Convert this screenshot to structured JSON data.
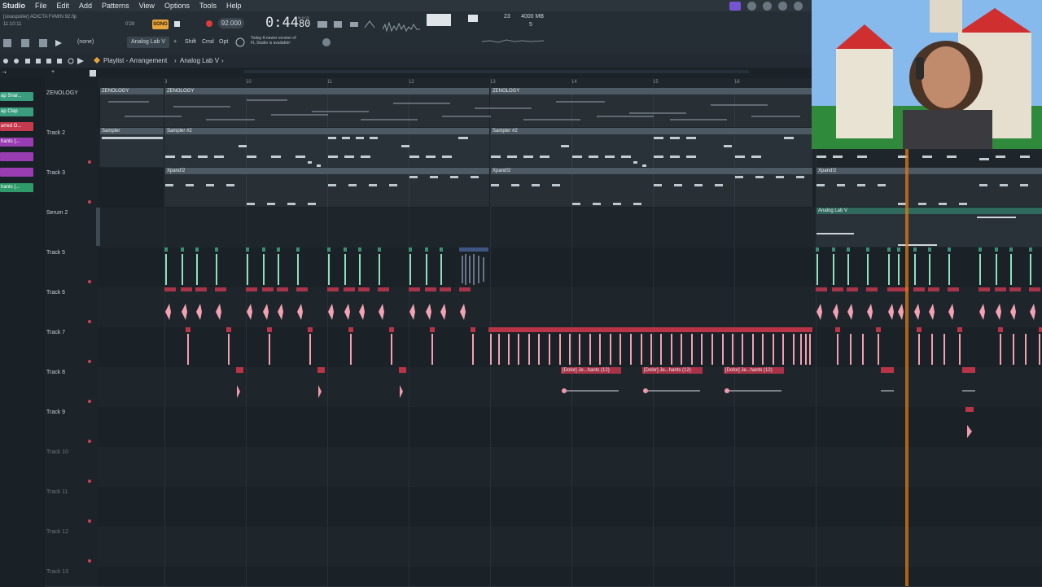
{
  "menubar": {
    "app": "Studio",
    "items": [
      "File",
      "Edit",
      "Add",
      "Patterns",
      "View",
      "Options",
      "Tools",
      "Help"
    ]
  },
  "toolbar": {
    "project_tag": "[sixaspoiler] ADICTA F#MIN 92.flp",
    "project_time": "11:10:11",
    "pattern_small": "0'28",
    "song_label": "SONG",
    "tempo": "92.000",
    "time_main": "0:44",
    "time_frac": "80",
    "time_unit": "M:S:CS",
    "cpu": "23",
    "memory": "4000 MB",
    "voices": "5",
    "voice_count": "0",
    "preset": "(none)",
    "plugin_button": "Analog Lab V",
    "shift_label": "Shift",
    "cmd_label": "Cmd",
    "opt_label": "Opt",
    "update_line1": "Today  A newer version of",
    "update_line2": "FL Studio is available!"
  },
  "breadcrumb": {
    "title": "Playlist - Arrangement",
    "current": "Analog Lab V"
  },
  "ruler": {
    "marks": [
      {
        "label": "9"
      },
      {
        "label": "10"
      },
      {
        "label": "11"
      },
      {
        "label": "12"
      },
      {
        "label": "13"
      },
      {
        "label": "14"
      },
      {
        "label": "15"
      },
      {
        "label": "16"
      }
    ]
  },
  "channel_rack": [
    {
      "label": "ap Snar...",
      "color": "g"
    },
    {
      "label": "ap Clap",
      "color": "g"
    },
    {
      "label": "arred O...",
      "color": "r"
    },
    {
      "label": "hants (...",
      "color": "p"
    },
    {
      "label": "",
      "color": "p"
    },
    {
      "label": "",
      "color": "p"
    },
    {
      "label": "hants (...",
      "color": "gr"
    }
  ],
  "tracks": [
    {
      "name": "ZENOLOGY"
    },
    {
      "name": "Track 2"
    },
    {
      "name": "Track 3"
    },
    {
      "name": "Serum 2"
    },
    {
      "name": "Track 5"
    },
    {
      "name": "Track 6"
    },
    {
      "name": "Track 7"
    },
    {
      "name": "Track 8"
    },
    {
      "name": "Track 9"
    },
    {
      "name": "Track 10"
    },
    {
      "name": "Track 11"
    },
    {
      "name": "Track 12"
    },
    {
      "name": "Track 13"
    }
  ],
  "clips": {
    "zenology": "ZENOLOGY",
    "sampler": "Sampler",
    "sampler2": "Sampler #2",
    "xpand": "Xpand!2",
    "analoglab": "Analog Lab V",
    "dolor": "[Dolor] Je...hants (12)"
  },
  "colors": {
    "playhead": "#e07916",
    "clip_pink": "#c43a4e",
    "clip_green": "#3fbf8e",
    "menu_accent": "#7454d1"
  }
}
